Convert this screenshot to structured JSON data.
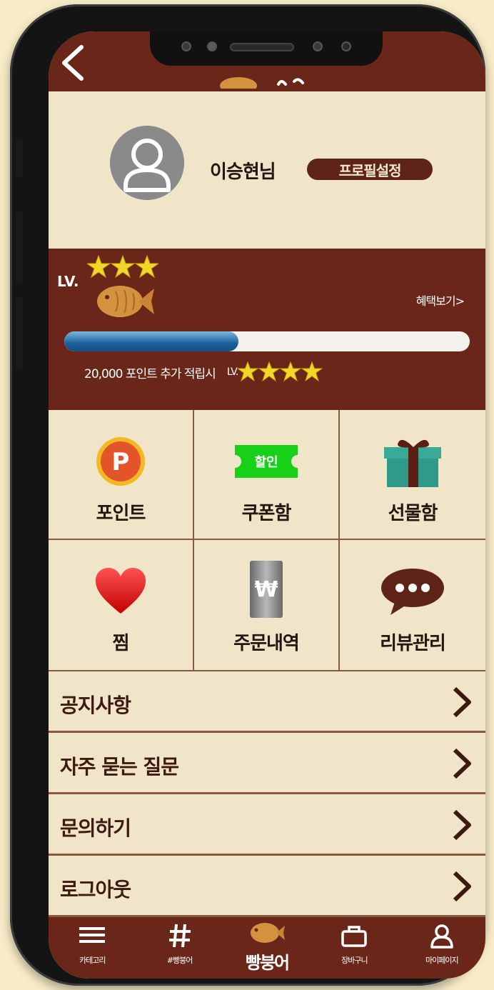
{
  "profile": {
    "username": "이승현님",
    "settings_button": "프로필설정"
  },
  "level": {
    "label": "LV.",
    "stars": 3,
    "benefit_link": "혜택보기>",
    "progress_fraction": 0.43,
    "next_info": "20,000 포인트 추가 적립시",
    "next_level_label": "LV.",
    "next_stars": 4,
    "colors": {
      "star": "#f3d62a",
      "bar": "#1d5f9a"
    }
  },
  "grid": [
    {
      "label": "포인트",
      "icon": "point-coin-icon"
    },
    {
      "label": "쿠폰함",
      "icon": "coupon-icon",
      "badge": "할인"
    },
    {
      "label": "선물함",
      "icon": "gift-box-icon"
    },
    {
      "label": "찜",
      "icon": "heart-icon"
    },
    {
      "label": "주문내역",
      "icon": "won-receipt-icon",
      "symbol": "₩"
    },
    {
      "label": "리뷰관리",
      "icon": "speech-bubble-icon"
    }
  ],
  "menu": [
    {
      "label": "공지사항"
    },
    {
      "label": "자주 묻는 질문"
    },
    {
      "label": "문의하기"
    },
    {
      "label": "로그아웃"
    }
  ],
  "nav": [
    {
      "label": "카테고리",
      "icon": "hamburger-icon"
    },
    {
      "label": "#빵붕어",
      "icon": "hashtag-icon"
    },
    {
      "label": "빵붕어",
      "icon": "fish-bread-logo"
    },
    {
      "label": "장바구니",
      "icon": "basket-icon"
    },
    {
      "label": "마이페이지",
      "icon": "person-icon"
    }
  ],
  "colors": {
    "primary": "#6a2618",
    "background": "#f0e5c8",
    "divider": "#8a5a3e"
  }
}
